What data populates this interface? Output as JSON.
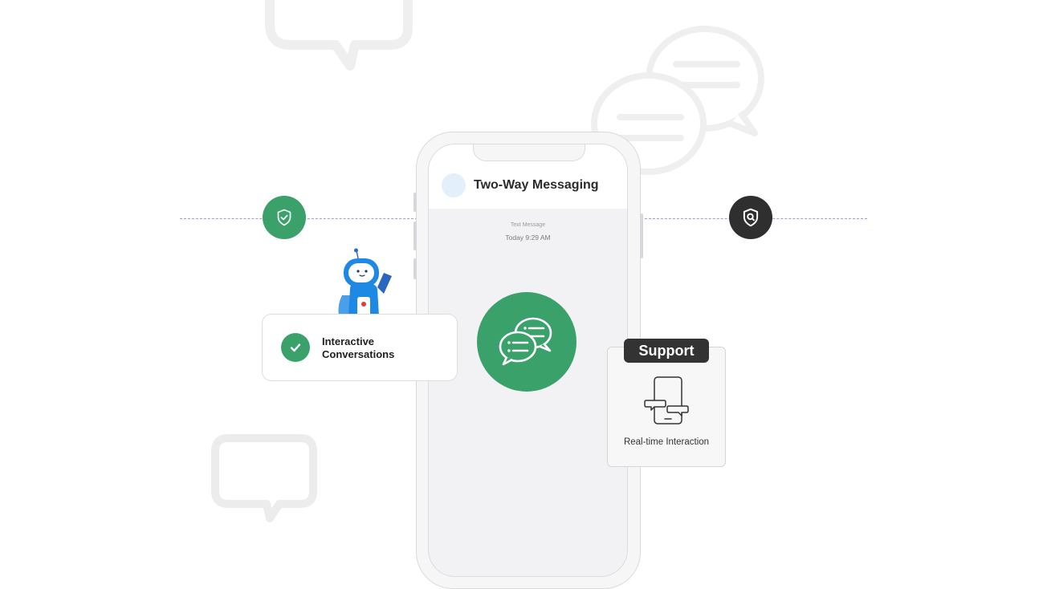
{
  "phone": {
    "contact_name": "Two-Way Messaging",
    "message_type": "Text Message",
    "message_time": "Today 9:29 AM"
  },
  "feature_card": {
    "title": "Interactive Conversations"
  },
  "support_card": {
    "tag": "Support",
    "label": "Real-time Interaction"
  },
  "icons": {
    "left_badge": "shield-check-icon",
    "right_badge": "shield-search-icon",
    "center": "chat-bubbles-icon",
    "feature_check": "check-icon",
    "support": "phone-chat-icon",
    "mascot": "robot-mascot-icon"
  },
  "colors": {
    "brand_green": "#3aa16b",
    "dark_badge": "#2f2f2f",
    "support_tag": "#333333",
    "dashed_line": "#9aa0cf",
    "robot_blue": "#1e88e5"
  }
}
